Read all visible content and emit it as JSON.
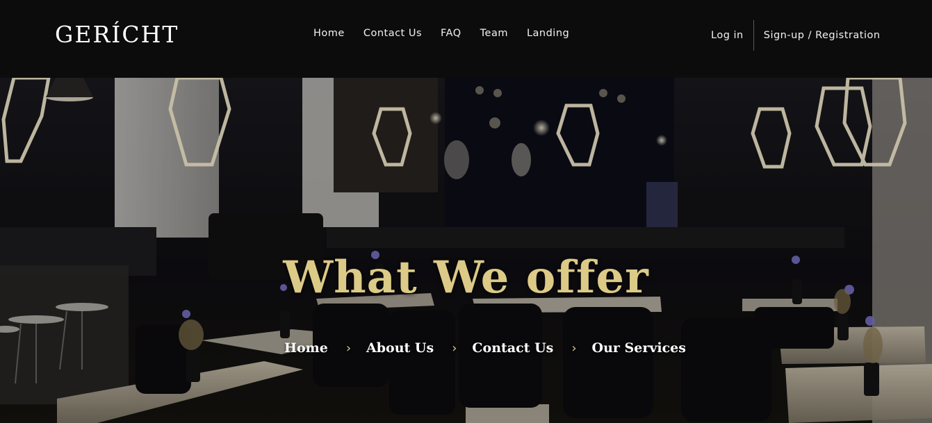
{
  "brand": {
    "logo": "GERÍCHT"
  },
  "nav": {
    "items": [
      "Home",
      "Contact Us",
      "FAQ",
      "Team",
      "Landing"
    ]
  },
  "auth": {
    "login": "Log in",
    "signup": "Sign-up / Registration"
  },
  "hero": {
    "title": "What We offer",
    "breadcrumbs": [
      "Home",
      "About Us",
      "Contact Us",
      "Our Services"
    ],
    "separator_icon": "chevron-right-icon"
  },
  "colors": {
    "accent_gold": "#dcca87",
    "nav_bg": "#0c0c0c",
    "text_white": "#ffffff"
  }
}
